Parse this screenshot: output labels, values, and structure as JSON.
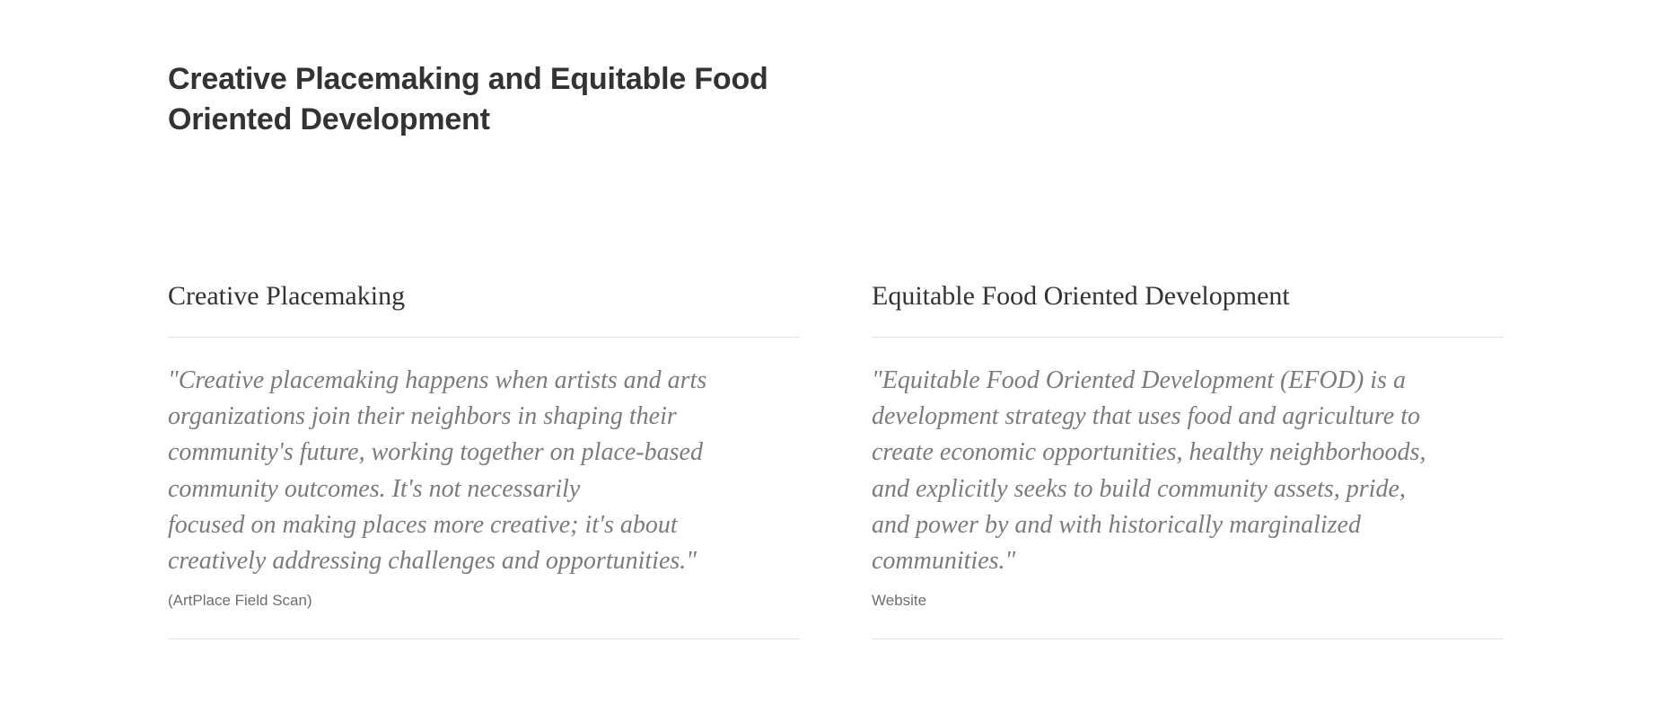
{
  "page": {
    "title": "Creative Placemaking and Equitable Food Oriented Development"
  },
  "sections": [
    {
      "heading": "Creative Placemaking",
      "quote_lines": [
        "\"Creative placemaking happens when artists and arts",
        "organizations join their neighbors in shaping their",
        "community's future, working together on place-based",
        "community outcomes. It's not necessarily",
        "focused on making places more creative; it's about",
        "creatively addressing challenges and opportunities.\""
      ],
      "source": "(ArtPlace Field Scan)"
    },
    {
      "heading": "Equitable Food Oriented Development",
      "quote_lines": [
        "\"Equitable Food Oriented Development (EFOD) is a",
        "development strategy that uses food and agriculture to",
        "create economic opportunities, healthy neighborhoods,",
        "and explicitly seeks to build community assets, pride,",
        "and power by and with historically marginalized",
        "communities.\""
      ],
      "source": "Website"
    }
  ]
}
